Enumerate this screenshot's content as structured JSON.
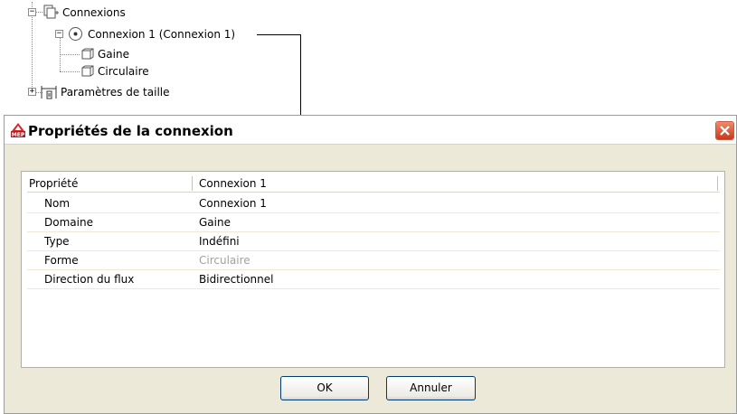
{
  "tree": {
    "connexions_label": "Connexions",
    "connexion1_label": "Connexion 1 (Connexion 1)",
    "gaine_label": "Gaine",
    "circulaire_label": "Circulaire",
    "parametres_label": "Paramètres de taille"
  },
  "dialog": {
    "title": "Propriétés de la connexion",
    "header": {
      "col1": "Propriété",
      "col2": "Connexion 1"
    },
    "rows": [
      {
        "name": "Nom",
        "value": "Connexion 1",
        "disabled": false
      },
      {
        "name": "Domaine",
        "value": "Gaine",
        "disabled": false
      },
      {
        "name": "Type",
        "value": "Indéfini",
        "disabled": false
      },
      {
        "name": "Forme",
        "value": "Circulaire",
        "disabled": true
      },
      {
        "name": "Direction du flux",
        "value": "Bidirectionnel",
        "disabled": false
      }
    ],
    "ok_label": "OK",
    "cancel_label": "Annuler"
  },
  "colors": {
    "dialog_bg": "#ece9d8",
    "close_button": "#d9533a",
    "disabled_text": "#a0a0a0"
  }
}
